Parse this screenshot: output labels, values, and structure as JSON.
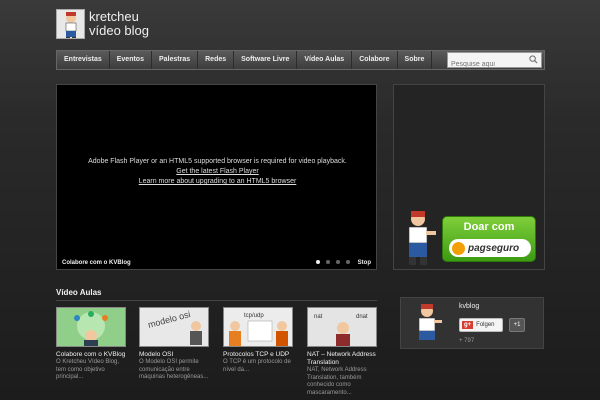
{
  "header": {
    "title_line1": "kretcheu",
    "title_line2": "vídeo blog"
  },
  "nav": {
    "items": [
      "Entrevistas",
      "Eventos",
      "Palestras",
      "Redes",
      "Software Livre",
      "Vídeo Aulas",
      "Colabore",
      "Sobre"
    ],
    "search_placeholder": "Pesquise aqui"
  },
  "video": {
    "message": "Adobe Flash Player or an HTML5 supported browser is required for video playback.",
    "link1": "Get the latest Flash Player",
    "link2": "Learn more about upgrading to an HTML5 browser",
    "caption": "Colabore com o KVBlog",
    "stop_label": "Stop"
  },
  "ad": {
    "donate_text": "Doar com",
    "brand_text": "pagseguro"
  },
  "section": {
    "title": "Vídeo Aulas"
  },
  "cards": [
    {
      "title": "Colabore com o KVBlog",
      "desc": "O Kretcheu Vídeo Blog, tem como objetivo principal..."
    },
    {
      "title": "Modelo OSI",
      "desc": "O Modelo OSI permite comunicação entre máquinas heterogêneas..."
    },
    {
      "title": "Protocolos TCP e UDP",
      "desc": "O TCP é um protocolo de nível da..."
    },
    {
      "title": "NAT – Network Address Translation",
      "desc": "NAT, Network Address Translation, também conhecido como mascaramento..."
    }
  ],
  "thumb_labels": {
    "osi": "modelo osi",
    "tcp": "tcp/udp",
    "nat": "nat",
    "dnat": "dnat"
  },
  "social": {
    "name": "kvblog",
    "follow_label": "Folgen",
    "plus_one": "+1",
    "count": "+ 797"
  },
  "colors": {
    "donate_green": "#4caf1e",
    "gplus_red": "#d73d32",
    "pag_orange": "#f29f05"
  }
}
